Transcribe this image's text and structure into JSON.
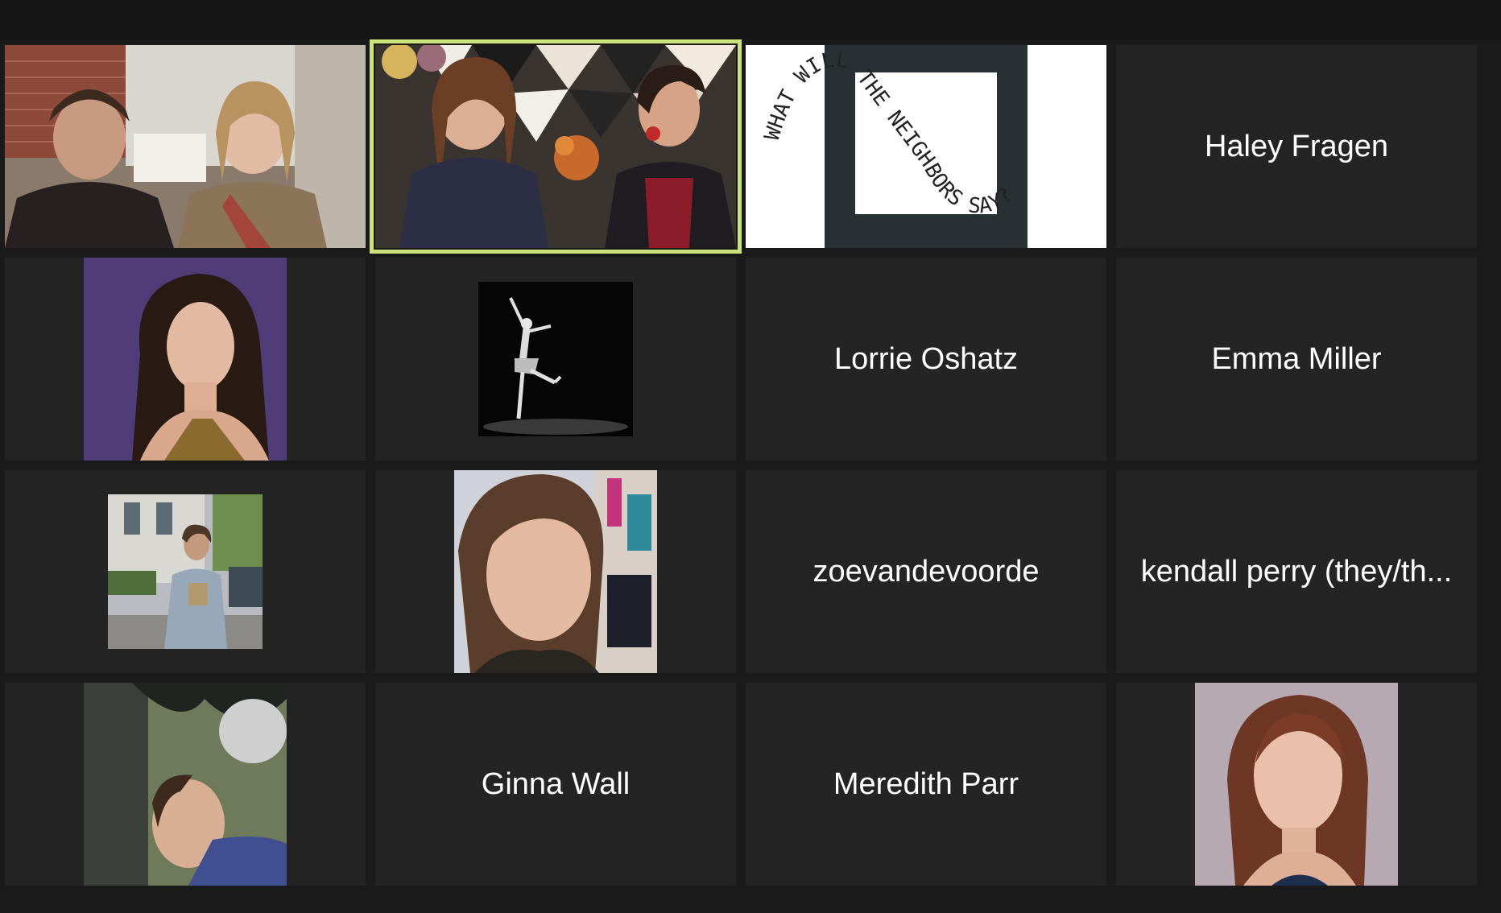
{
  "participants": [
    {
      "type": "video",
      "label": ""
    },
    {
      "type": "video",
      "label": "",
      "active_speaker": true
    },
    {
      "type": "logo",
      "logo_text": "WHAT WILL THE NEIGHBORS SAY?"
    },
    {
      "type": "name",
      "name": "Haley Fragen"
    },
    {
      "type": "photo",
      "label": ""
    },
    {
      "type": "photo",
      "label": ""
    },
    {
      "type": "name",
      "name": "Lorrie Oshatz"
    },
    {
      "type": "name",
      "name": "Emma Miller"
    },
    {
      "type": "photo",
      "label": ""
    },
    {
      "type": "photo",
      "label": ""
    },
    {
      "type": "name",
      "name": "zoevandevoorde"
    },
    {
      "type": "name",
      "name": "kendall perry (they/th..."
    },
    {
      "type": "photo",
      "label": ""
    },
    {
      "type": "name",
      "name": "Ginna Wall"
    },
    {
      "type": "name",
      "name": "Meredith Parr"
    },
    {
      "type": "photo",
      "label": ""
    }
  ],
  "colors": {
    "background": "#1a1a1a",
    "tile": "#242424",
    "active_speaker_border": "#c9e27a",
    "name_text": "#ffffff"
  }
}
